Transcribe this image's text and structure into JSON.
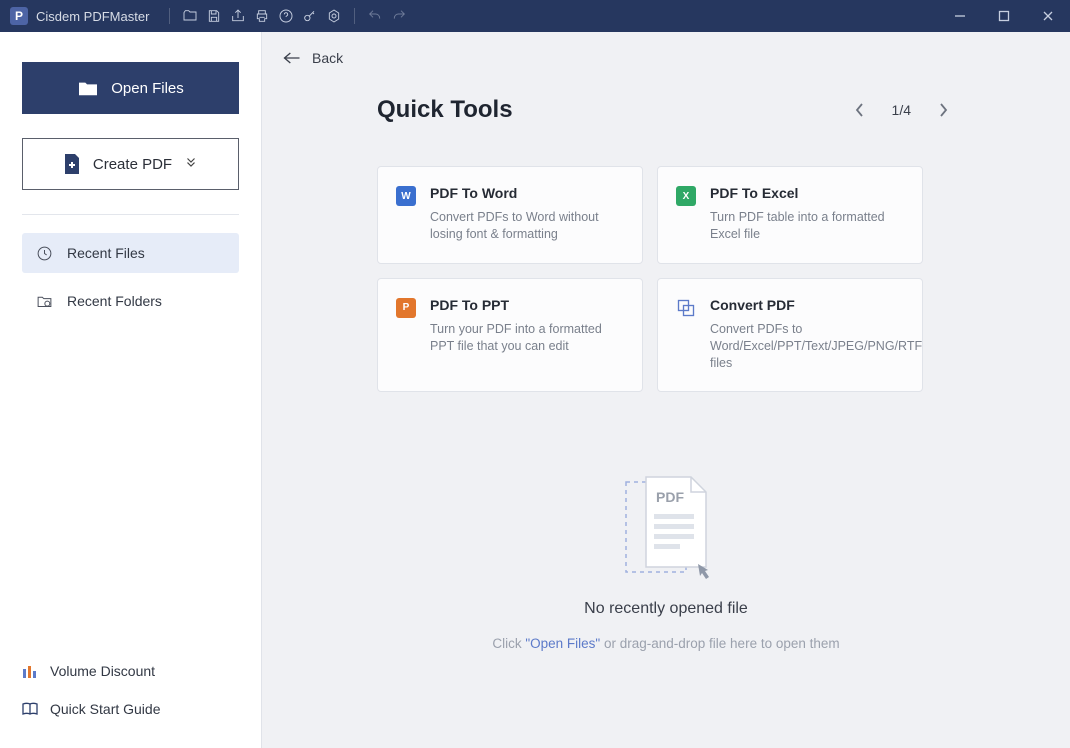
{
  "titlebar": {
    "app_name": "Cisdem PDFMaster"
  },
  "sidebar": {
    "open_files_label": "Open Files",
    "create_pdf_label": "Create PDF",
    "items": [
      {
        "label": "Recent Files"
      },
      {
        "label": "Recent Folders"
      }
    ],
    "footer": [
      {
        "label": "Volume Discount"
      },
      {
        "label": "Quick Start Guide"
      }
    ]
  },
  "content": {
    "back_label": "Back",
    "quick_tools_title": "Quick Tools",
    "pager": {
      "page": "1/4"
    },
    "tools": [
      {
        "title": "PDF To Word",
        "desc": "Convert PDFs to Word without losing font & formatting"
      },
      {
        "title": "PDF To Excel",
        "desc": "Turn PDF table into a formatted Excel file"
      },
      {
        "title": "PDF To PPT",
        "desc": "Turn your PDF into a formatted PPT file that you can edit"
      },
      {
        "title": "Convert PDF",
        "desc": "Convert PDFs to Word/Excel/PPT/Text/JPEG/PNG/RTF files"
      }
    ],
    "empty": {
      "title": "No recently opened file",
      "sub_prefix": "Click ",
      "sub_link": "\"Open Files\"",
      "sub_suffix": " or drag-and-drop file here to open them"
    }
  }
}
